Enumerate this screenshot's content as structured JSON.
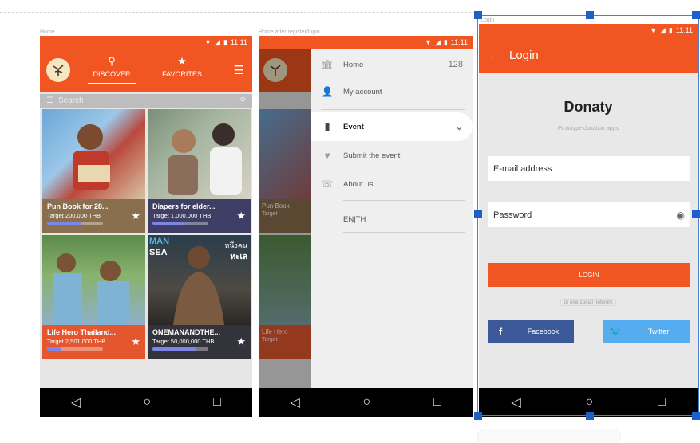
{
  "labels": {
    "screen1": "Home",
    "screen2": "Home after register/login",
    "screen3": "Login"
  },
  "status": {
    "time": "11:11"
  },
  "discover": {
    "tabs": [
      {
        "label": "DISCOVER"
      },
      {
        "label": "FAVORITES"
      }
    ],
    "search_placeholder": "Search",
    "cards": [
      {
        "title": "Pun Book for 28...",
        "target": "Target 200,000 THB",
        "progress": 0.62,
        "color": "#8a6f4e"
      },
      {
        "title": "Diapers for elder...",
        "target": "Target 1,000,000 THB",
        "progress": 0.55,
        "color": "#3f3f66"
      },
      {
        "title": "Life Hero Thailand...",
        "target": "Target 2,501,000 THB",
        "progress": 0.25,
        "color": "#e4572e"
      },
      {
        "title": "ONEMANANDTHE...",
        "target": "Target 50,000,000 THB",
        "progress": 0.78,
        "color": "#33333c"
      }
    ],
    "poster_text": {
      "top": "MAN",
      "mid": "SEA",
      "thai1": "หนึ่งคน",
      "thai2": "ทะเล"
    }
  },
  "drawer": {
    "items": [
      {
        "label": "Home",
        "value": "128"
      },
      {
        "label": "My account"
      },
      {
        "label": "Event"
      },
      {
        "label": "Submit the event"
      },
      {
        "label": "About us"
      },
      {
        "label": "EN|TH"
      }
    ],
    "bg_card_labels": [
      "Pun Book",
      "Target",
      "Life Hero",
      "Target"
    ]
  },
  "login": {
    "title": "Login",
    "brand": "Donaty",
    "tagline": "Prototype donation apps",
    "email_placeholder": "E-mail address",
    "password_placeholder": "Password",
    "button": "LOGIN",
    "or_text": "or use social network",
    "facebook": "Facebook",
    "twitter": "Twitter"
  },
  "colors": {
    "primary": "#f05522",
    "facebook": "#3b5998",
    "twitter": "#55acee",
    "selection": "#1f5fc9"
  }
}
